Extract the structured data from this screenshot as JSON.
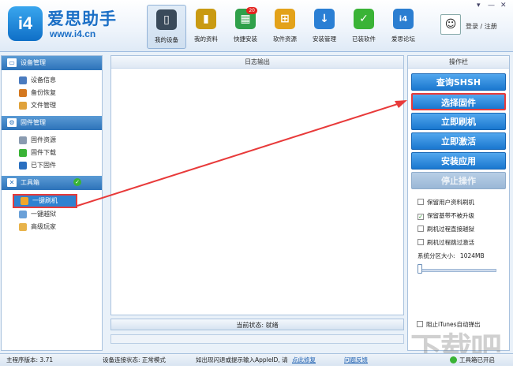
{
  "app": {
    "brand": "爱思助手",
    "url": "www.i4.cn",
    "logo_text": "i4",
    "login_text": "登录 / 注册"
  },
  "nav": [
    {
      "label": "我的设备",
      "icon": "phone-icon",
      "color": "#3a4a5a",
      "active": true
    },
    {
      "label": "我的资料",
      "icon": "chart-icon",
      "color": "#c99a12"
    },
    {
      "label": "快捷安装",
      "icon": "apps-icon",
      "color": "#2fa04a",
      "badge": "20"
    },
    {
      "label": "软件资源",
      "icon": "grid-icon",
      "color": "#e3a21a"
    },
    {
      "label": "安装管理",
      "icon": "download-icon",
      "color": "#2a7fd4"
    },
    {
      "label": "已装软件",
      "icon": "check-icon",
      "color": "#3ab336"
    },
    {
      "label": "爱思论坛",
      "icon": "i4-forum-icon",
      "color": "#2b7ed1"
    }
  ],
  "sidebar": {
    "sections": [
      {
        "title": "设备管理",
        "icon": "monitor-icon",
        "items": [
          {
            "label": "设备信息",
            "color": "#4a7bbf"
          },
          {
            "label": "备份恢复",
            "color": "#d4781f"
          },
          {
            "label": "文件管理",
            "color": "#e0a23a"
          }
        ]
      },
      {
        "title": "固件管理",
        "icon": "gear-icon",
        "items": [
          {
            "label": "固件资源",
            "color": "#8a9bb0"
          },
          {
            "label": "固件下载",
            "color": "#3ab336"
          },
          {
            "label": "已下固件",
            "color": "#2a6fc0"
          }
        ]
      },
      {
        "title": "工具箱",
        "icon": "tools-icon",
        "items": [
          {
            "label": "一键刷机",
            "color": "#f2a62a",
            "selected": true
          },
          {
            "label": "一键越狱",
            "color": "#6aa0d8"
          },
          {
            "label": "高级玩家",
            "color": "#e8b34a"
          }
        ]
      }
    ]
  },
  "log": {
    "title": "日志输出"
  },
  "status": {
    "text": "当前状态: 就绪"
  },
  "ops": {
    "title": "操作栏",
    "buttons": [
      {
        "label": "查询SHSH"
      },
      {
        "label": "选择固件"
      },
      {
        "label": "立即刷机"
      },
      {
        "label": "立即激活"
      },
      {
        "label": "安装应用"
      },
      {
        "label": "停止操作"
      }
    ],
    "options": [
      {
        "label": "保留用户资料刷机",
        "checked": false
      },
      {
        "label": "保留基带不被升级",
        "checked": true
      },
      {
        "label": "刷机过程直接越狱",
        "checked": false
      },
      {
        "label": "刷机过程跳过激活",
        "checked": false
      }
    ],
    "partition_label": "系统分区大小:",
    "partition_value": "1024MB",
    "itunes_label": "阻止iTunes自动弹出"
  },
  "footer": {
    "version": "主程序版本: 3.71",
    "connection": "设备连接状态: 正常模式",
    "hint": "如出现闪退或提示输入AppleID, 请",
    "fix_link": "点此修复",
    "feedback": "问题反馈",
    "toolbox_status": "工具箱已开启"
  },
  "colors": {
    "accent": "#1a77cf",
    "highlight": "#e83a3a"
  }
}
